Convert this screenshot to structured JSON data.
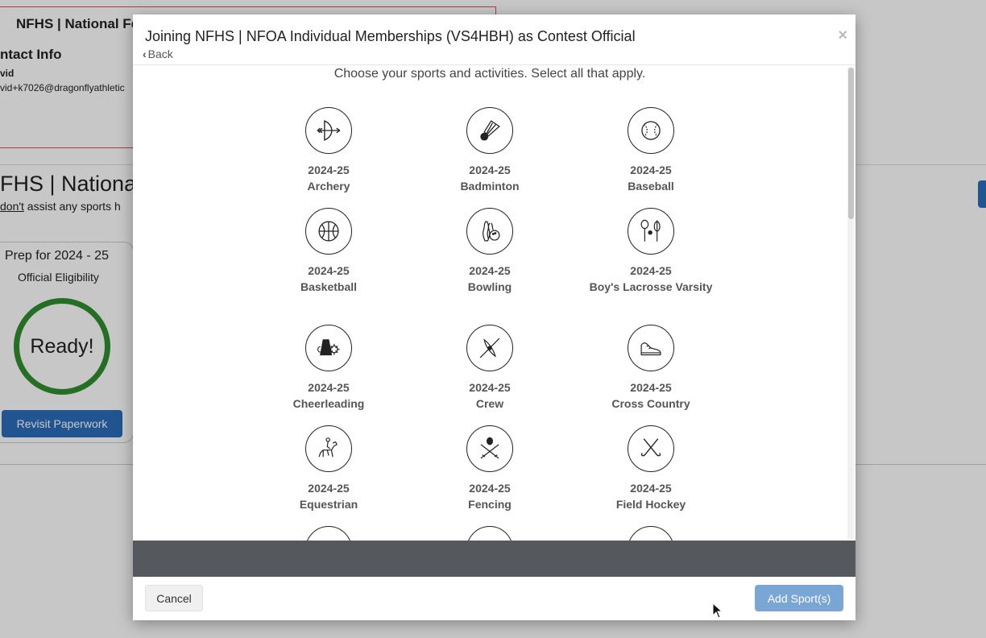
{
  "background": {
    "org_title": "NFHS | National Fe",
    "contact_heading": "ntact Info",
    "contact_name": "vid",
    "contact_email": "vid+k7026@dragonflyathletic",
    "org_heading": "FHS | Nationa",
    "note_prefix": "",
    "note_emphasis": "don't",
    "note_suffix": " assist any sports h",
    "eligibility_title": "Prep for 2024 - 25",
    "eligibility_subtitle": "Official Eligibility",
    "status_text": "Ready!",
    "revisit_button": "Revisit Paperwork"
  },
  "modal": {
    "title": "Joining NFHS | NFOA Individual Memberships (VS4HBH) as Contest Official",
    "close_label": "×",
    "back_label": "Back",
    "instructions": "Choose your sports and activities. Select all that apply.",
    "sports": [
      {
        "year": "2024-25",
        "name": "Archery",
        "icon": "archery-icon"
      },
      {
        "year": "2024-25",
        "name": "Badminton",
        "icon": "shuttlecock-icon"
      },
      {
        "year": "2024-25",
        "name": "Baseball",
        "icon": "baseball-icon"
      },
      {
        "year": "2024-25",
        "name": "Basketball",
        "icon": "basketball-icon"
      },
      {
        "year": "2024-25",
        "name": "Bowling",
        "icon": "bowling-icon"
      },
      {
        "year": "2024-25",
        "name": "Boy's Lacrosse Varsity",
        "icon": "lacrosse-icon"
      },
      {
        "year": "2024-25",
        "name": "Cheerleading",
        "icon": "megaphone-icon"
      },
      {
        "year": "2024-25",
        "name": "Crew",
        "icon": "oar-icon"
      },
      {
        "year": "2024-25",
        "name": "Cross Country",
        "icon": "shoe-icon"
      },
      {
        "year": "2024-25",
        "name": "Equestrian",
        "icon": "horse-icon"
      },
      {
        "year": "2024-25",
        "name": "Fencing",
        "icon": "fencing-icon"
      },
      {
        "year": "2024-25",
        "name": "Field Hockey",
        "icon": "field-hockey-icon"
      }
    ],
    "cancel_label": "Cancel",
    "add_label": "Add Sport(s)"
  }
}
